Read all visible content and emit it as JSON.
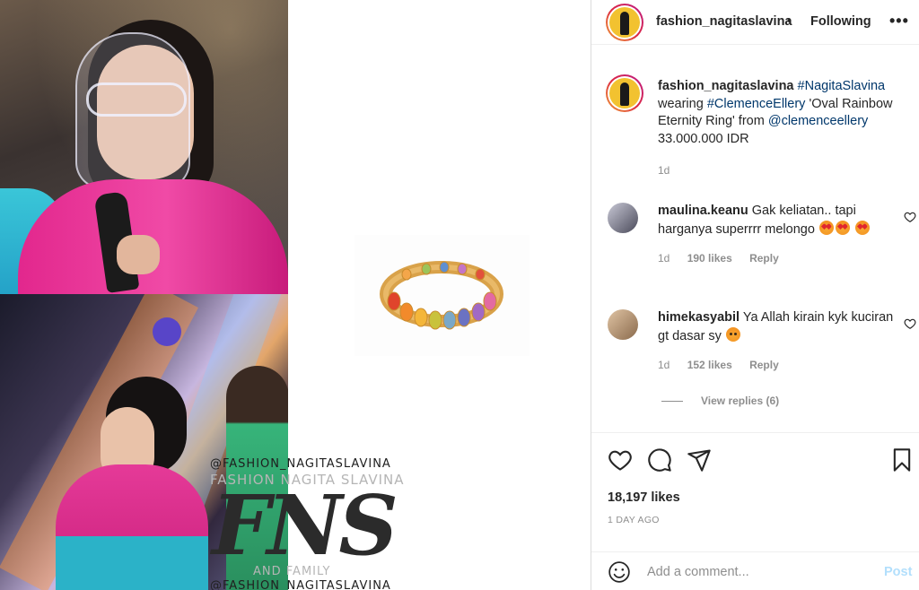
{
  "post": {
    "username": "fashion_nagitaslavina",
    "separator": "•",
    "follow_status": "Following",
    "more_icon": "more-options-icon",
    "more_glyph": "•••"
  },
  "caption": {
    "username": "fashion_nagitaslavina",
    "hashtag1": "#NagitaSlavina",
    "text1": "wearing",
    "hashtag2": "#ClemenceEllery",
    "text2": "'Oval Rainbow Eternity Ring' from",
    "mention": "@clemenceellery",
    "price": "33.000.000 IDR",
    "time": "1d"
  },
  "comments": [
    {
      "username": "maulina.keanu",
      "text": "Gak keliatan.. tapi harganya superrrr melongo",
      "time": "1d",
      "likes": "190 likes",
      "reply": "Reply"
    },
    {
      "username": "himekasyabil",
      "text": "Ya Allah kirain kyk kuciran gt dasar sy",
      "time": "1d",
      "likes": "152 likes",
      "reply": "Reply"
    }
  ],
  "view_replies": "View replies (6)",
  "likes_count": "18,197 likes",
  "posted_ago": "1 DAY AGO",
  "comment_input": {
    "placeholder": "Add a comment...",
    "post_label": "Post"
  },
  "watermark": {
    "top": "@FASHION_NAGITASLAVINA",
    "mid": "FASHION NAGITA SLAVINA",
    "big": "FNS",
    "family": "AND FAMILY",
    "bottom": "@FASHION_NAGITASLAVINA"
  },
  "colors": {
    "link": "#00376b",
    "muted": "#8e8e8e",
    "post_disabled": "#b2dffc",
    "story_ring": [
      "#f09433",
      "#dc2743",
      "#bc1888"
    ]
  }
}
